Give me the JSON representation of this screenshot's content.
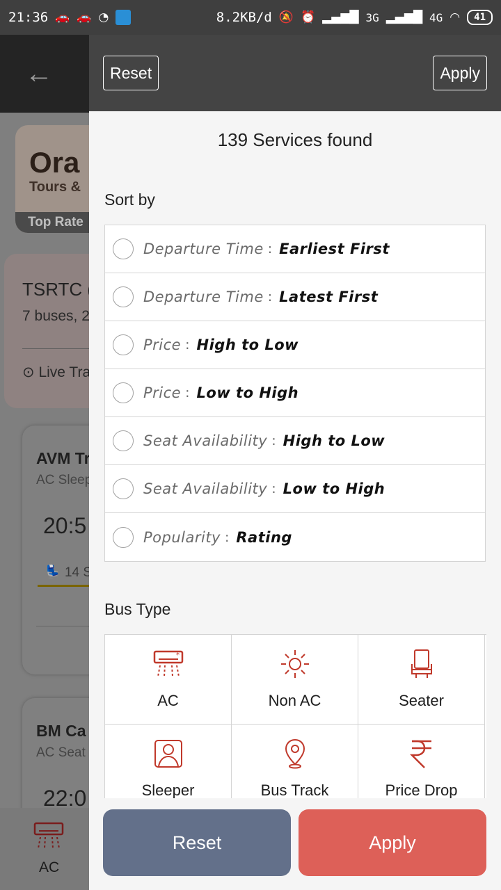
{
  "status_bar": {
    "time": "21:36",
    "network_speed": "8.2KB/d",
    "signal1_label": "3G",
    "signal2_label": "4G",
    "battery": "41"
  },
  "background": {
    "promo_title": "Ora",
    "promo_subtitle": "Tours &",
    "promo_badge": "Top Rate",
    "operator_title": "TSRTC (",
    "operator_buses": "7 buses, 2",
    "operator_live": "Live Tra",
    "bus1": {
      "name": "AVM Tr",
      "type": "AC Sleep",
      "time": "20:5",
      "seats": "14 S"
    },
    "bus2": {
      "name": "BM Ca",
      "type": "AC Seat",
      "time": "22:0"
    },
    "bottom_tab": "AC"
  },
  "drawer": {
    "header_reset": "Reset",
    "header_apply": "Apply",
    "services_found": "139 Services found",
    "sort_title": "Sort by",
    "sort_options": [
      {
        "label": "Departure Time",
        "value": "Earliest First"
      },
      {
        "label": "Departure Time",
        "value": "Latest First"
      },
      {
        "label": "Price",
        "value": "High to Low"
      },
      {
        "label": "Price",
        "value": "Low to High"
      },
      {
        "label": "Seat Availability",
        "value": "High to Low"
      },
      {
        "label": "Seat Availability",
        "value": "Low to High"
      },
      {
        "label": "Popularity",
        "value": "Rating"
      }
    ],
    "bus_type_title": "Bus Type",
    "bus_types": [
      {
        "label": "AC",
        "icon": "ac-icon"
      },
      {
        "label": "Non AC",
        "icon": "sun-icon"
      },
      {
        "label": "Seater",
        "icon": "seat-icon"
      },
      {
        "label": "Sleeper",
        "icon": "sleeper-icon"
      },
      {
        "label": "Bus Track",
        "icon": "location-pin-icon"
      },
      {
        "label": "Price Drop",
        "icon": "rupee-icon"
      }
    ],
    "footer_reset": "Reset",
    "footer_apply": "Apply"
  },
  "colors": {
    "accent_red": "#c0392b",
    "reset_button": "#63708a",
    "apply_button": "#dd6058",
    "header": "#444444"
  }
}
